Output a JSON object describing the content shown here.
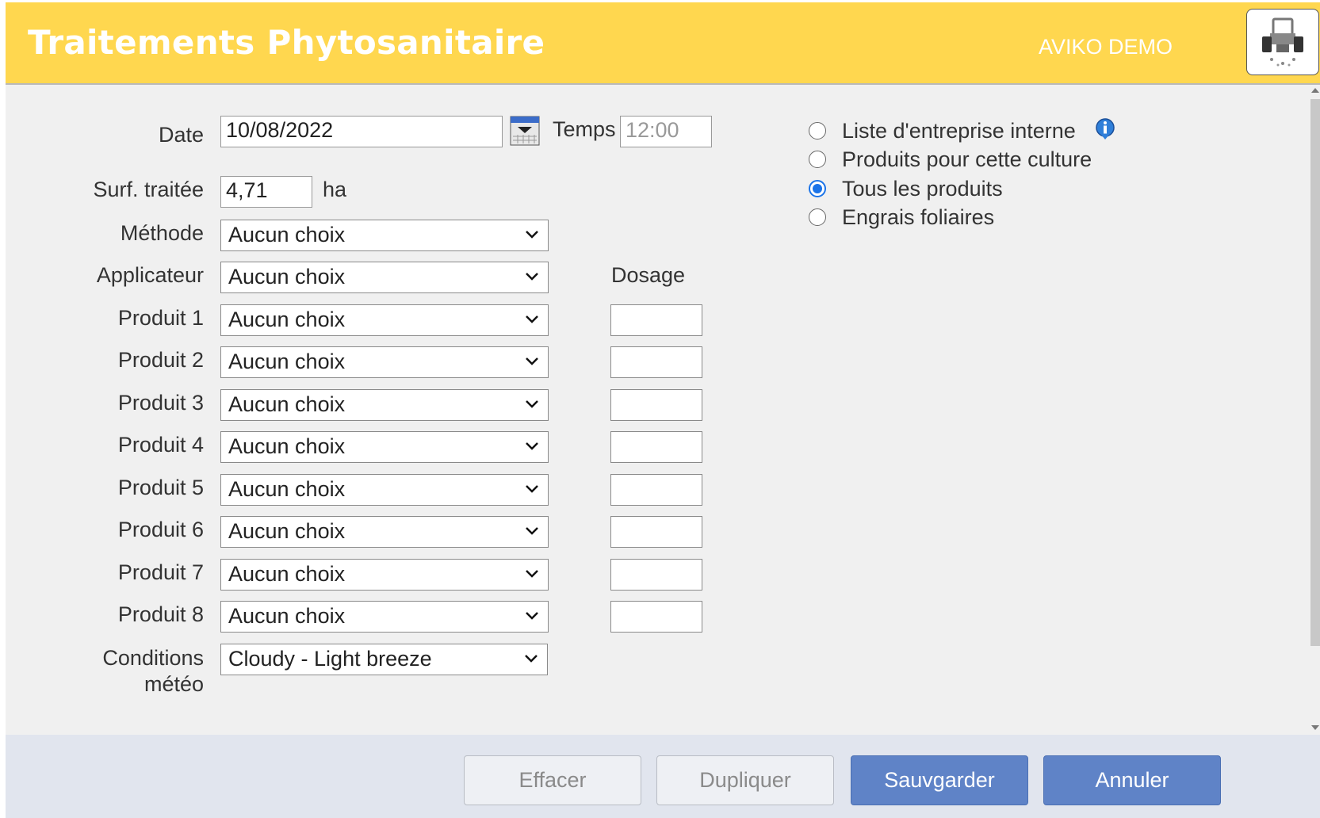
{
  "header": {
    "title": "Traitements Phytosanitaire",
    "company": "AVIKO DEMO",
    "avatar_icon": "tractor-icon"
  },
  "form": {
    "date_label": "Date",
    "date_value": "10/08/2022",
    "time_label": "Temps",
    "time_placeholder": "12:00",
    "surface_label": "Surf. traitée",
    "surface_value": "4,71",
    "surface_unit": "ha",
    "method_label": "Méthode",
    "method_value": "Aucun choix",
    "applicator_label": "Applicateur",
    "applicator_value": "Aucun choix",
    "dosage_label": "Dosage",
    "products": [
      {
        "label": "Produit 1",
        "value": "Aucun choix"
      },
      {
        "label": "Produit 2",
        "value": "Aucun choix"
      },
      {
        "label": "Produit 3",
        "value": "Aucun choix"
      },
      {
        "label": "Produit 4",
        "value": "Aucun choix"
      },
      {
        "label": "Produit 5",
        "value": "Aucun choix"
      },
      {
        "label": "Produit 6",
        "value": "Aucun choix"
      },
      {
        "label": "Produit 7",
        "value": "Aucun choix"
      },
      {
        "label": "Produit 8",
        "value": "Aucun choix"
      }
    ],
    "weather_label_line1": "Conditions",
    "weather_label_line2": "météo",
    "weather_value": "Cloudy - Light breeze"
  },
  "product_filter": {
    "options": [
      {
        "label": "Liste d'entreprise interne",
        "checked": false
      },
      {
        "label": "Produits pour cette culture",
        "checked": false
      },
      {
        "label": "Tous les produits",
        "checked": true
      },
      {
        "label": "Engrais foliaires",
        "checked": false
      }
    ]
  },
  "footer": {
    "clear_label": "Effacer",
    "duplicate_label": "Dupliquer",
    "save_label": "Sauvgarder",
    "cancel_label": "Annuler"
  },
  "colors": {
    "header_bg": "#ffd74f",
    "primary_button": "#5f83c7",
    "radio_checked": "#1a73e8"
  }
}
